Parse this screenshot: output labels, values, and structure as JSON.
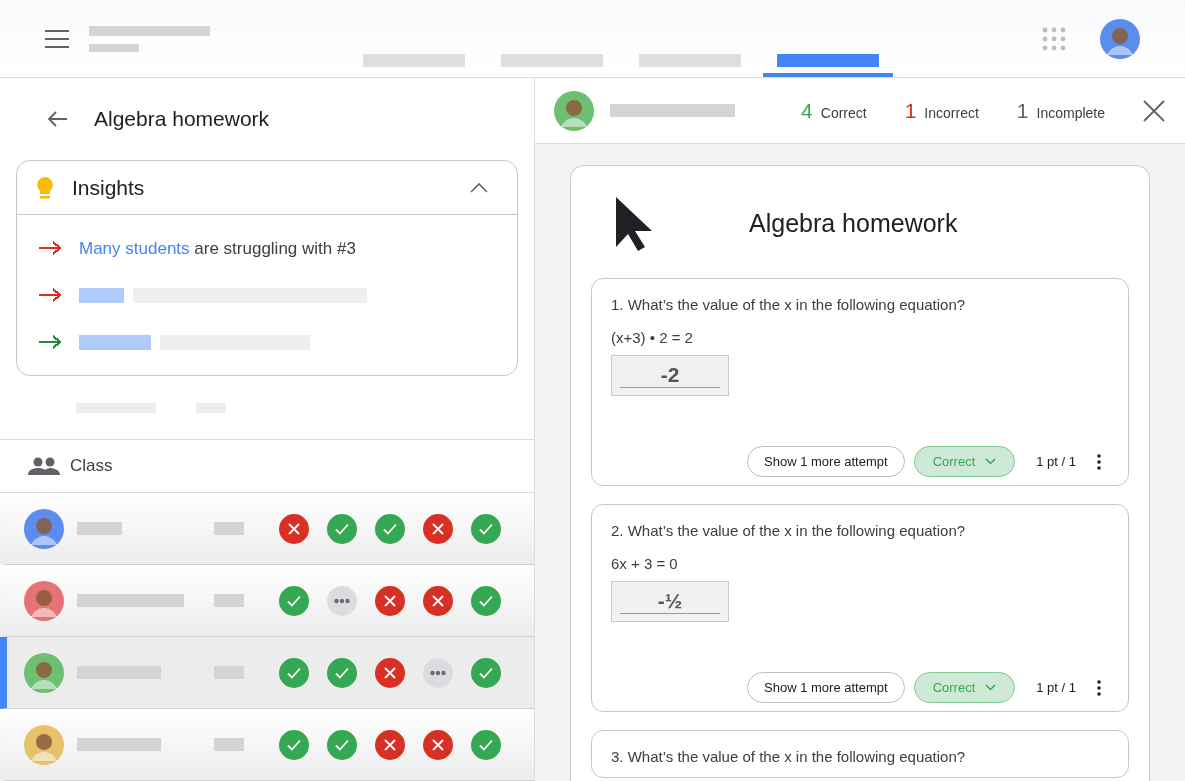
{
  "header": {
    "tabs": [
      {
        "selected": false
      },
      {
        "selected": false
      },
      {
        "selected": false
      },
      {
        "selected": true
      }
    ]
  },
  "left_panel": {
    "title": "Algebra homework",
    "insights": {
      "title": "Insights",
      "expanded": true,
      "items": [
        {
          "color": "#d93025",
          "highlight": "Many students",
          "text": "are struggling with #3"
        },
        {
          "color": "#d93025"
        },
        {
          "color": "#1e8e3e"
        }
      ]
    },
    "class_label": "Class",
    "students": [
      {
        "selected": false,
        "color": "#5b8def",
        "results": [
          {
            "kind": "incorrect"
          },
          {
            "kind": "correct"
          },
          {
            "kind": "correct"
          },
          {
            "kind": "incorrect"
          },
          {
            "kind": "correct"
          }
        ]
      },
      {
        "selected": false,
        "color": "#e57373",
        "results": [
          {
            "kind": "correct"
          },
          {
            "kind": "incomplete"
          },
          {
            "kind": "incorrect"
          },
          {
            "kind": "incorrect"
          },
          {
            "kind": "correct"
          }
        ]
      },
      {
        "selected": true,
        "color": "#6fbf73",
        "results": [
          {
            "kind": "correct"
          },
          {
            "kind": "correct"
          },
          {
            "kind": "incorrect"
          },
          {
            "kind": "incomplete"
          },
          {
            "kind": "correct"
          }
        ]
      },
      {
        "selected": false,
        "color": "#e6c36a",
        "results": [
          {
            "kind": "correct"
          },
          {
            "kind": "correct"
          },
          {
            "kind": "incorrect"
          },
          {
            "kind": "incorrect"
          },
          {
            "kind": "correct"
          }
        ]
      }
    ]
  },
  "right_panel": {
    "summary": [
      {
        "count": "4",
        "label": "Correct",
        "color": "#34a853"
      },
      {
        "count": "1",
        "label": "Incorrect",
        "color": "#d93025"
      },
      {
        "count": "1",
        "label": "Incomplete",
        "color": "#5f6368"
      }
    ],
    "title": "Algebra homework",
    "questions": [
      {
        "prompt": "1. What’s the value of the x in the following equation?",
        "equation": "(x+3) • 2 = 2",
        "answer": "-2",
        "attempt_button": "Show 1 more attempt",
        "grade": "Correct",
        "points": "1 pt / 1"
      },
      {
        "prompt": "2. What’s the value of the x in the following equation?",
        "equation": "6x + 3 = 0",
        "answer": "-½",
        "attempt_button": "Show 1 more attempt",
        "grade": "Correct",
        "points": "1 pt / 1"
      },
      {
        "prompt": "3. What’s the value of the x in the following equation?"
      }
    ]
  }
}
